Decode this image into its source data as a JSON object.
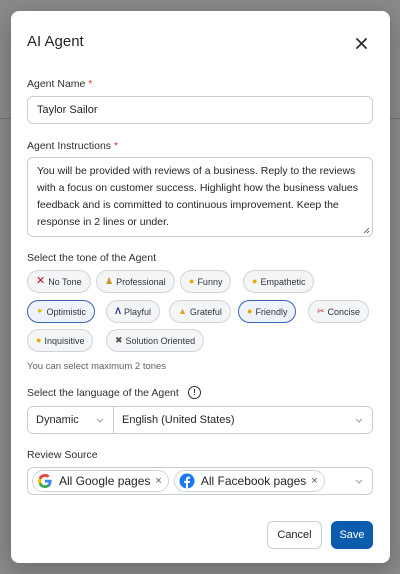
{
  "modal": {
    "title": "AI Agent"
  },
  "agent_name": {
    "label": "Agent Name",
    "required_mark": "*",
    "value": "Taylor Sailor"
  },
  "agent_instructions": {
    "label": "Agent Instructions",
    "required_mark": "*",
    "value": "You will be provided with reviews of a business. Reply to the reviews with a focus on customer success. Highlight how the business values feedback and is committed to continuous improvement. Keep the response in 2 lines or under."
  },
  "tone": {
    "label": "Select the tone of the Agent",
    "chips": [
      {
        "label": "No Tone",
        "icon": "red-x-icon",
        "selected": false
      },
      {
        "label": "Professional",
        "icon": "professional-person-icon",
        "selected": false
      },
      {
        "label": "Funny",
        "icon": "laughing-face-icon",
        "selected": false
      },
      {
        "label": "Empathetic",
        "icon": "empathetic-face-icon",
        "selected": false
      },
      {
        "label": "Optimistic",
        "icon": "sparkle-icon",
        "selected": true
      },
      {
        "label": "Playful",
        "icon": "playful-icon",
        "selected": false
      },
      {
        "label": "Grateful",
        "icon": "folded-hands-icon",
        "selected": false
      },
      {
        "label": "Friendly",
        "icon": "smiling-face-icon",
        "selected": true
      },
      {
        "label": "Concise",
        "icon": "scissors-icon",
        "selected": false
      },
      {
        "label": "Inquisitive",
        "icon": "thinking-face-icon",
        "selected": false
      },
      {
        "label": "Solution Oriented",
        "icon": "tools-icon",
        "selected": false
      }
    ],
    "hint": "You can select maximum 2 tones"
  },
  "language": {
    "label": "Select the language of the Agent",
    "mode": "Dynamic",
    "value": "English (United States)",
    "info_icon": "!"
  },
  "review_source": {
    "label": "Review Source",
    "sources": [
      {
        "label": "All Google pages",
        "icon": "google-icon",
        "remove": "×"
      },
      {
        "label": "All Facebook pages",
        "icon": "facebook-icon",
        "remove": "×"
      }
    ]
  },
  "actions": {
    "cancel_label": "Cancel",
    "save_label": "Save"
  },
  "colors": {
    "primary": "#0b5cad",
    "selected_chip_border": "#3b63b8",
    "required": "#d93025"
  }
}
